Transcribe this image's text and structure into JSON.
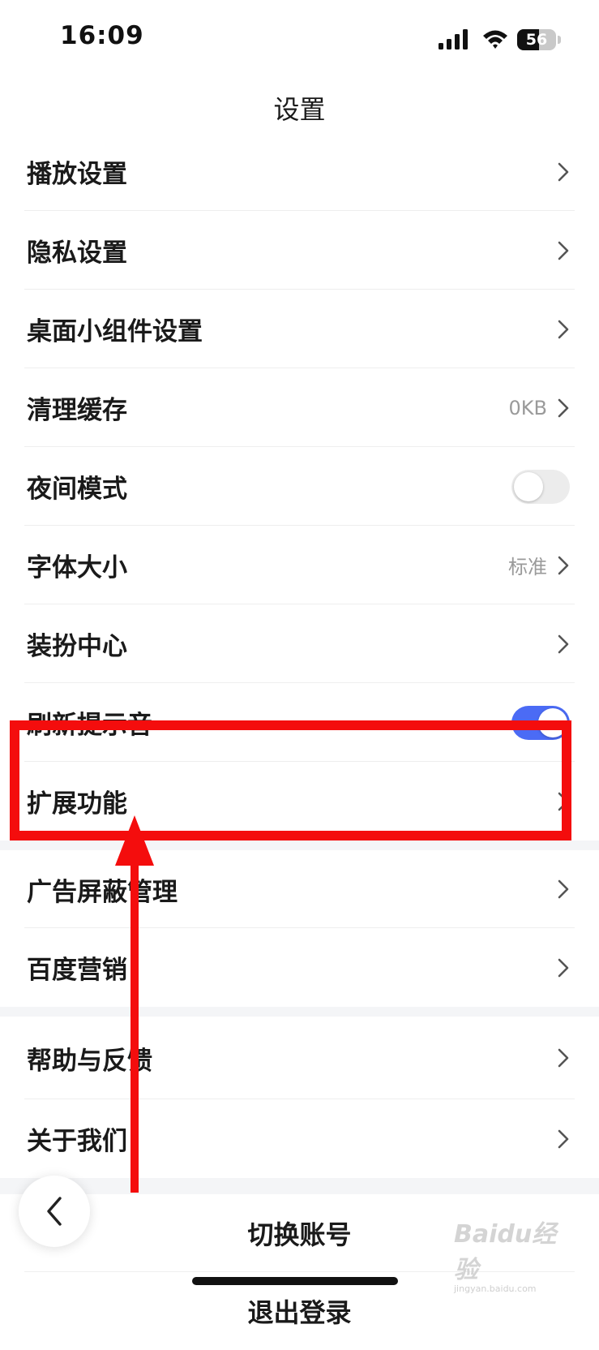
{
  "status_bar": {
    "time": "16:09",
    "battery": "56",
    "battery_level_percent": 56
  },
  "header": {
    "title": "设置"
  },
  "settings": {
    "items": [
      {
        "label": "播放设置",
        "value": "",
        "control": "chevron"
      },
      {
        "label": "隐私设置",
        "value": "",
        "control": "chevron"
      },
      {
        "label": "桌面小组件设置",
        "value": "",
        "control": "chevron"
      },
      {
        "label": "清理缓存",
        "value": "0KB",
        "control": "chevron"
      },
      {
        "label": "夜间模式",
        "value": "",
        "control": "toggle",
        "enabled": false
      },
      {
        "label": "字体大小",
        "value": "标准",
        "control": "chevron"
      },
      {
        "label": "装扮中心",
        "value": "",
        "control": "chevron"
      },
      {
        "label": "刷新提示音",
        "value": "",
        "control": "toggle",
        "enabled": true
      },
      {
        "label": "扩展功能",
        "value": "",
        "control": "chevron"
      },
      {
        "label": "广告屏蔽管理",
        "value": "",
        "control": "chevron"
      },
      {
        "label": "百度营销",
        "value": "",
        "control": "chevron"
      }
    ],
    "support_items": [
      {
        "label": "帮助与反馈",
        "value": "",
        "control": "chevron"
      },
      {
        "label": "关于我们",
        "value": "",
        "control": "chevron"
      }
    ]
  },
  "account": {
    "switch_label": "切换账号",
    "logout_label": "退出登录"
  },
  "annotation": {
    "highlighted_item": "扩展功能",
    "color": "#f40d0d"
  },
  "watermark": {
    "logo": "Baidu经验",
    "url": "jingyan.baidu.com"
  },
  "colors": {
    "accent": "#4b6bf5",
    "divider": "#eeeeee",
    "secondary_text": "#9a9a9a"
  }
}
